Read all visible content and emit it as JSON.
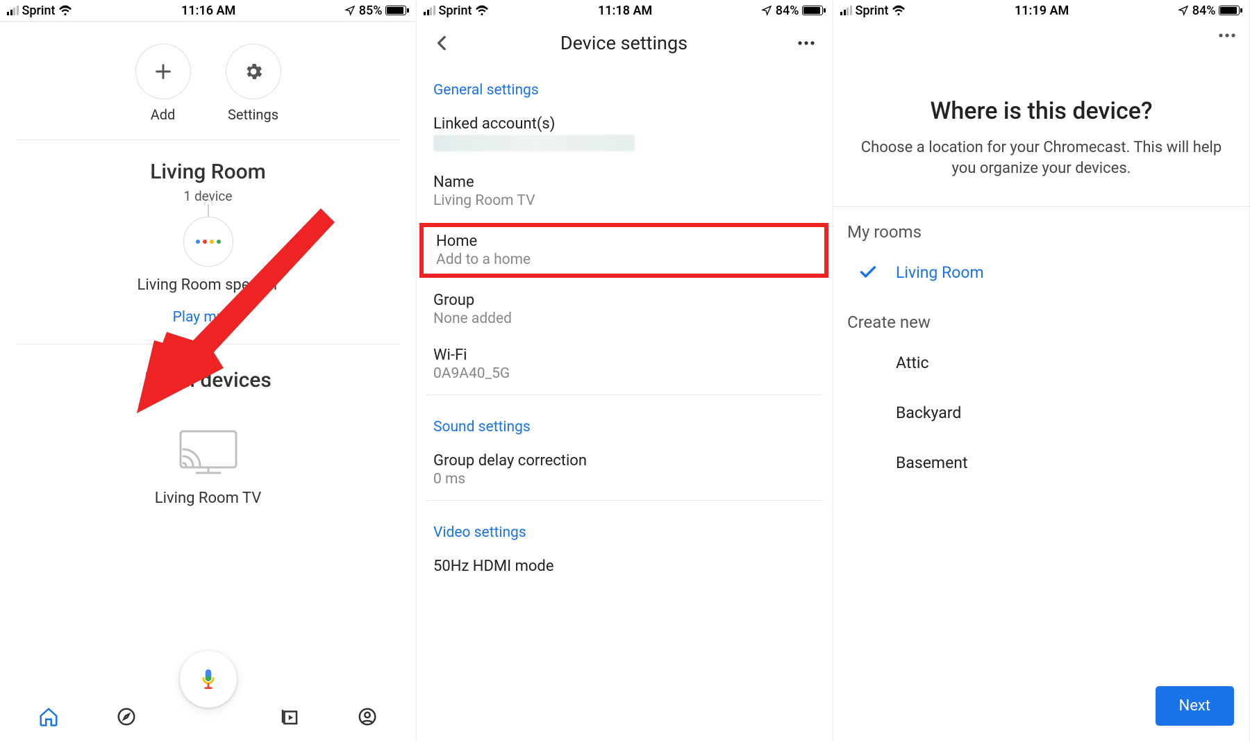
{
  "screen1": {
    "status": {
      "carrier": "Sprint",
      "time": "11:16 AM",
      "battery_pct": "85%",
      "battery_fill": 85
    },
    "actions": {
      "add": "Add",
      "settings": "Settings"
    },
    "room": {
      "title": "Living Room",
      "subtitle": "1 device"
    },
    "speaker": {
      "name": "Living Room speaker",
      "play": "Play music"
    },
    "local": {
      "title": "Local devices",
      "tv": "Living Room TV"
    }
  },
  "screen2": {
    "status": {
      "carrier": "Sprint",
      "time": "11:18 AM",
      "battery_pct": "84%",
      "battery_fill": 84
    },
    "header": "Device settings",
    "sections": {
      "general": "General settings",
      "linked": {
        "label": "Linked account(s)"
      },
      "name": {
        "label": "Name",
        "value": "Living Room TV"
      },
      "home": {
        "label": "Home",
        "value": "Add to a home"
      },
      "group": {
        "label": "Group",
        "value": "None added"
      },
      "wifi": {
        "label": "Wi-Fi",
        "value": "0A9A40_5G"
      },
      "sound": "Sound settings",
      "delay": {
        "label": "Group delay correction",
        "value": "0 ms"
      },
      "video": "Video settings",
      "hdmi": {
        "label": "50Hz HDMI mode"
      }
    }
  },
  "screen3": {
    "status": {
      "carrier": "Sprint",
      "time": "11:19 AM",
      "battery_pct": "84%",
      "battery_fill": 84
    },
    "heading": "Where is this device?",
    "sub": "Choose a location for your Chromecast. This will help you organize your devices.",
    "myrooms": "My rooms",
    "selected": "Living Room",
    "createnew": "Create new",
    "options": [
      "Attic",
      "Backyard",
      "Basement"
    ],
    "next": "Next"
  }
}
